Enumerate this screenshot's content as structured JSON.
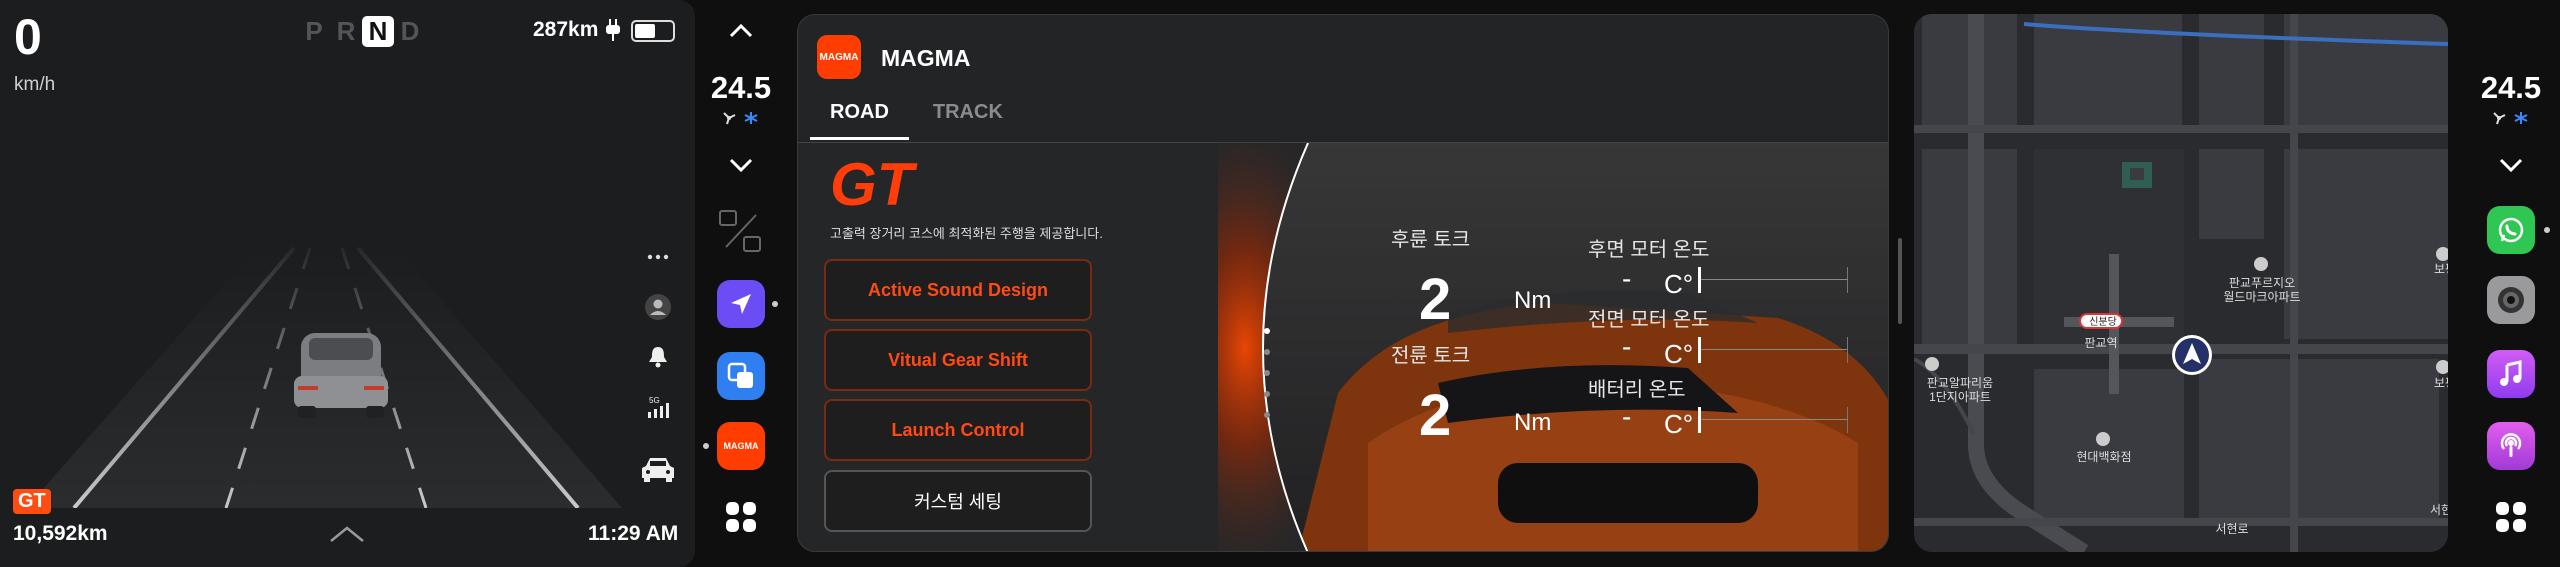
{
  "cluster": {
    "speed": "0",
    "speed_unit": "km/h",
    "gears": [
      "P",
      "R",
      "N",
      "D"
    ],
    "active_gear": "N",
    "range": "287km",
    "battery_level": 0.55,
    "drive_mode": "GT",
    "odometer": "10,592km",
    "time": "11:29 AM",
    "side_icons": [
      "more-icon",
      "profile-icon",
      "bell-icon",
      "signal-5g-icon",
      "car-icon"
    ]
  },
  "left_dock": {
    "temperature": "24.5",
    "fan_icons": "fan-icon snowflake-icon",
    "apps": [
      "seat-heater",
      "navigation",
      "connect",
      "magma",
      "app-grid"
    ],
    "magma_label": "MAGMA"
  },
  "panel": {
    "brand_logo_text": "MAGMA",
    "brand_name": "MAGMA",
    "tabs": [
      {
        "label": "ROAD",
        "active": true
      },
      {
        "label": "TRACK",
        "active": false
      }
    ],
    "mode_title": "GT",
    "mode_description": "고출력 장거리 코스에 최적화된 주행을 제공합니다.",
    "buttons": [
      "Active Sound Design",
      "Vitual Gear Shift",
      "Launch Control",
      "커스텀 세팅"
    ],
    "stats": {
      "rear_torque_label": "후륜 토크",
      "rear_torque_value": "2",
      "front_torque_label": "전륜 토크",
      "front_torque_value": "2",
      "torque_unit": "Nm",
      "rear_motor_temp_label": "후면 모터 온도",
      "front_motor_temp_label": "전면 모터 온도",
      "battery_temp_label": "배터리 온도",
      "temp_value": "-",
      "temp_unit": "C°"
    },
    "accent": "#ff3d00"
  },
  "map": {
    "labels": {
      "station": "신분당",
      "pangyo": "판교역",
      "pangyo_alpharium": "판교알파리움\n1단지아파트",
      "hyundai": "현대백화점",
      "pangyo_prugio": "판교푸르지오\n월드마크아파트",
      "seohyeon": "서현로",
      "bo_top": "보평",
      "bo_mid": "보평",
      "seo_right": "서현"
    }
  },
  "right_dock": {
    "temperature": "24.5",
    "apps": [
      "whatsapp",
      "camera",
      "music",
      "podcasts",
      "app-grid"
    ]
  }
}
